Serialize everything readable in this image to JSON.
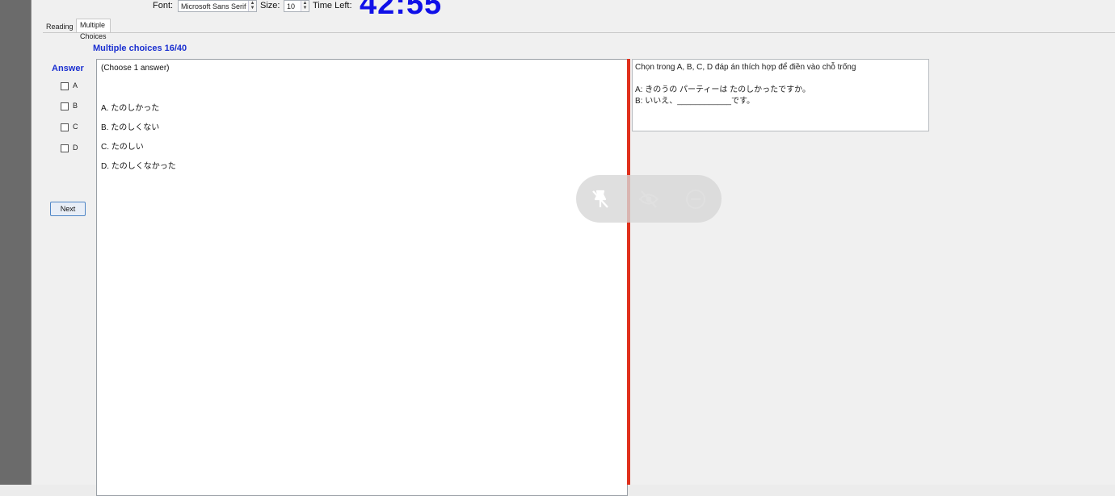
{
  "toolbar": {
    "font_label": "Font:",
    "font_value": "Microsoft Sans Serif",
    "size_label": "Size:",
    "size_value": "10",
    "time_label": "Time Left:",
    "time_value": "42:55"
  },
  "tabs": [
    {
      "label": "Reading"
    },
    {
      "label": "Multiple Choices"
    }
  ],
  "section_title": "Multiple choices 16/40",
  "answer": {
    "heading": "Answer",
    "options": [
      "A",
      "B",
      "C",
      "D"
    ],
    "next_label": "Next"
  },
  "question": {
    "instruction": "(Choose 1 answer)",
    "options": [
      "A. たのしかった",
      "B. たのしくない",
      "C. たのしい",
      "D. たのしくなかった"
    ]
  },
  "prompt": {
    "instruction": "Chọn trong A, B, C, D đáp án thích hợp để điền vào chỗ trống",
    "line_a": "A:  きのうの  パーティーは  たのしかったですか。",
    "line_b": "B:  いいえ、____________です。"
  },
  "colors": {
    "accent": "#1a2fd0",
    "timer": "#1010e8",
    "divider": "#e0301c"
  },
  "overlay_icons": [
    "unpin-icon",
    "mute-icon",
    "minimize-icon"
  ]
}
